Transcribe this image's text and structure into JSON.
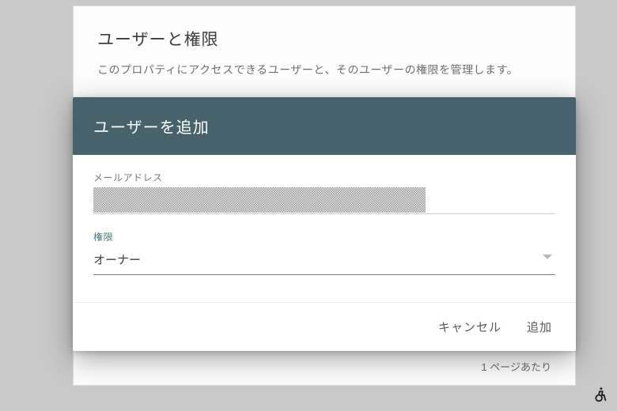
{
  "card": {
    "title": "ユーザーと権限",
    "subtitle": "このプロパティにアクセスできるユーザーと、そのユーザーの権限を管理します。",
    "pager": "1 ページあたり"
  },
  "dialog": {
    "title": "ユーザーを追加",
    "email_label": "メールアドレス",
    "email_value": "",
    "permission_label": "権限",
    "permission_value": "オーナー",
    "cancel_label": "キャンセル",
    "submit_label": "追加"
  }
}
